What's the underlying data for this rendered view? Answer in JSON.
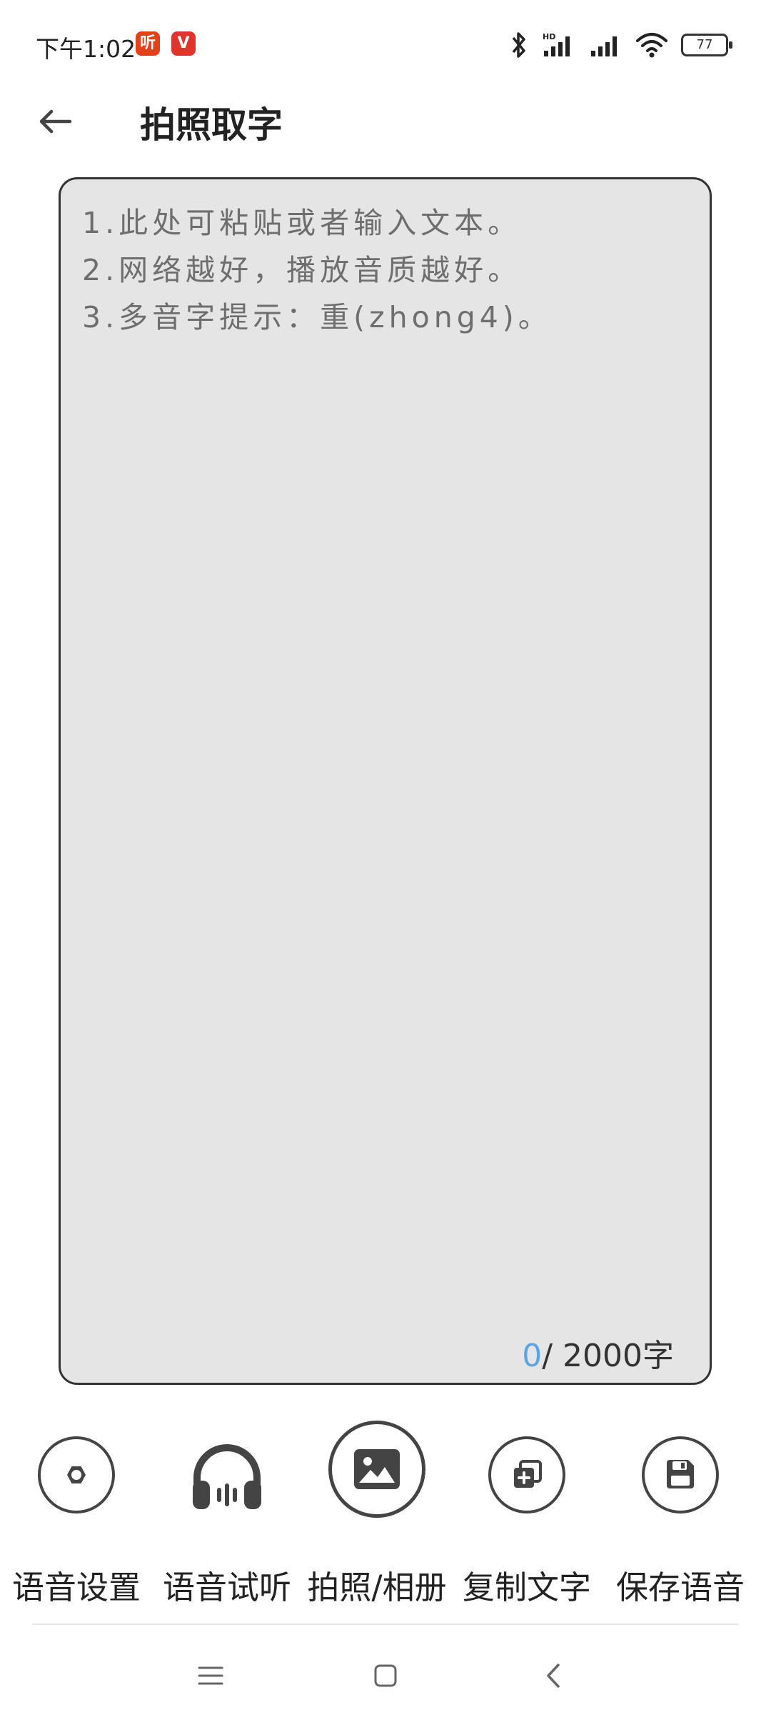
{
  "status_bar": {
    "time": "下午1:02",
    "badge_1": "听",
    "badge_2": "V",
    "network_label": "HD",
    "battery": "77"
  },
  "header": {
    "title": "拍照取字"
  },
  "editor": {
    "hint_lines": [
      "1.此处可粘贴或者输入文本。",
      "2.网络越好，播放音质越好。",
      "3.多音字提示：重(zhong4)。"
    ],
    "count_current": "0",
    "count_total": "/ 2000字"
  },
  "toolbar": {
    "items": [
      {
        "label": "语音设置",
        "icon": "settings-icon"
      },
      {
        "label": "语音试听",
        "icon": "headphones-icon"
      },
      {
        "label": "拍照/相册",
        "icon": "image-icon"
      },
      {
        "label": "复制文字",
        "icon": "copy-icon"
      },
      {
        "label": "保存语音",
        "icon": "save-icon"
      }
    ]
  },
  "colors": {
    "accent_count": "#5aa4e6",
    "panel_bg": "#e5e5e5"
  }
}
